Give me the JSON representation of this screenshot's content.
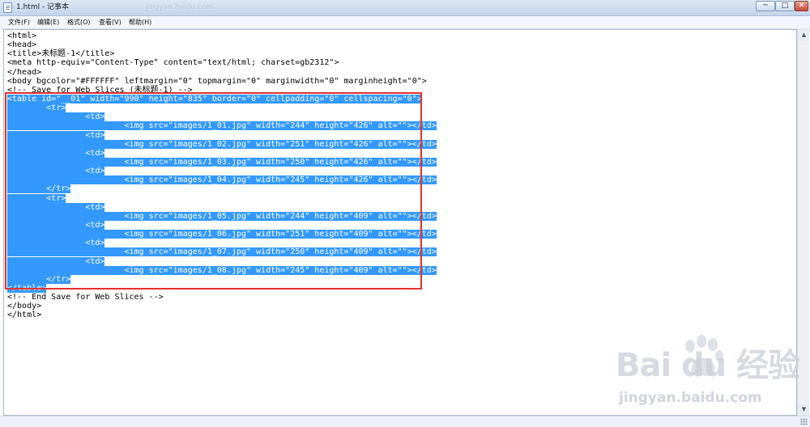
{
  "window": {
    "title": "1.html - 记事本",
    "title_watermark": "jingyan.baidu.com",
    "minimize": "─",
    "maximize": "□",
    "close": "✕"
  },
  "menubar": [
    "文件(F)",
    "编辑(E)",
    "格式(O)",
    "查看(V)",
    "帮助(H)"
  ],
  "editor": {
    "lines": [
      {
        "indent": "",
        "text": "<html>",
        "selected": false
      },
      {
        "indent": "",
        "text": "<head>",
        "selected": false
      },
      {
        "indent": "",
        "text": "<title>未标题-1</title>",
        "selected": false
      },
      {
        "indent": "",
        "text": "<meta http-equiv=\"Content-Type\" content=\"text/html; charset=gb2312\">",
        "selected": false
      },
      {
        "indent": "",
        "text": "</head>",
        "selected": false
      },
      {
        "indent": "",
        "text": "<body bgcolor=\"#FFFFFF\" leftmargin=\"0\" topmargin=\"0\" marginwidth=\"0\" marginheight=\"0\">",
        "selected": false
      },
      {
        "indent": "",
        "text": "<!-- Save for Web Slices (未标题-1) -->",
        "selected": false
      },
      {
        "indent": "",
        "text": "<table id=\"__01\" width=\"990\" height=\"835\" border=\"0\" cellpadding=\"0\" cellspacing=\"0\">",
        "selected": true
      },
      {
        "indent": "        ",
        "text": "<tr>",
        "selected": true
      },
      {
        "indent": "                ",
        "text": "<td>",
        "selected": true
      },
      {
        "indent": "                        ",
        "text": "<img src=\"images/1_01.jpg\" width=\"244\" height=\"426\" alt=\"\"></td>",
        "selected": true
      },
      {
        "indent": "                ",
        "text": "<td>",
        "selected": true
      },
      {
        "indent": "                        ",
        "text": "<img src=\"images/1_02.jpg\" width=\"251\" height=\"426\" alt=\"\"></td>",
        "selected": true
      },
      {
        "indent": "                ",
        "text": "<td>",
        "selected": true
      },
      {
        "indent": "                        ",
        "text": "<img src=\"images/1_03.jpg\" width=\"250\" height=\"426\" alt=\"\"></td>",
        "selected": true
      },
      {
        "indent": "                ",
        "text": "<td>",
        "selected": true
      },
      {
        "indent": "                        ",
        "text": "<img src=\"images/1_04.jpg\" width=\"245\" height=\"426\" alt=\"\"></td>",
        "selected": true
      },
      {
        "indent": "        ",
        "text": "</tr>",
        "selected": true
      },
      {
        "indent": "        ",
        "text": "<tr>",
        "selected": true
      },
      {
        "indent": "                ",
        "text": "<td>",
        "selected": true
      },
      {
        "indent": "                        ",
        "text": "<img src=\"images/1_05.jpg\" width=\"244\" height=\"409\" alt=\"\"></td>",
        "selected": true
      },
      {
        "indent": "                ",
        "text": "<td>",
        "selected": true
      },
      {
        "indent": "                        ",
        "text": "<img src=\"images/1_06.jpg\" width=\"251\" height=\"409\" alt=\"\"></td>",
        "selected": true
      },
      {
        "indent": "                ",
        "text": "<td>",
        "selected": true
      },
      {
        "indent": "                        ",
        "text": "<img src=\"images/1_07.jpg\" width=\"250\" height=\"409\" alt=\"\"></td>",
        "selected": true
      },
      {
        "indent": "                ",
        "text": "<td>",
        "selected": true
      },
      {
        "indent": "                        ",
        "text": "<img src=\"images/1_08.jpg\" width=\"245\" height=\"409\" alt=\"\"></td>",
        "selected": true
      },
      {
        "indent": "        ",
        "text": "</tr>",
        "selected": true
      },
      {
        "indent": "",
        "text": "</table>",
        "selected": true
      },
      {
        "indent": "",
        "text": "<!-- End Save for Web Slices -->",
        "selected": false
      },
      {
        "indent": "",
        "text": "</body>",
        "selected": false
      },
      {
        "indent": "",
        "text": "</html>",
        "selected": false
      }
    ]
  },
  "watermark": {
    "logo": "Bai du 经验",
    "url": "jingyan.baidu.com"
  },
  "colors": {
    "selection": "#3399ff",
    "highlight_box": "#e5302f"
  },
  "icons": {
    "app": "notepad-icon",
    "minimize": "minimize-icon",
    "maximize": "maximize-icon",
    "close": "close-icon"
  }
}
